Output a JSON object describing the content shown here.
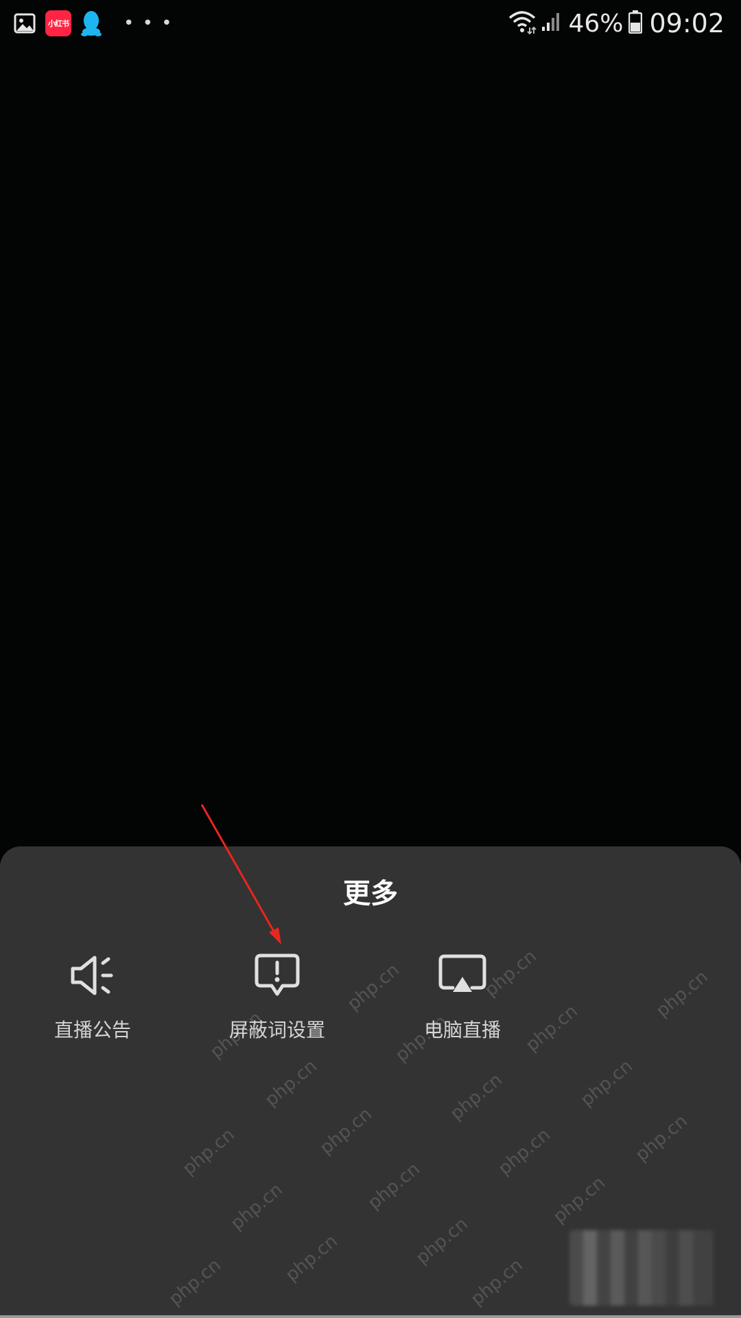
{
  "status_bar": {
    "app_badge_text": "小红书",
    "more_dots": "• • •",
    "battery_percent": "46%",
    "time": "09:02"
  },
  "sheet": {
    "title": "更多",
    "options": [
      {
        "label": "直播公告",
        "icon": "speaker-icon"
      },
      {
        "label": "屏蔽词设置",
        "icon": "alert-bubble-icon"
      },
      {
        "label": "电脑直播",
        "icon": "screen-cast-icon"
      }
    ]
  },
  "watermark": {
    "text": "php.cn"
  },
  "colors": {
    "screen_bg": "#030404",
    "sheet_bg": "#333333",
    "title": "#ffffff",
    "label": "#d4d4d4",
    "icon_stroke": "#e0e0e0",
    "annotation_arrow": "#e8261f",
    "app_badge": "#ff2442",
    "qq_blue": "#1eb4f0"
  }
}
